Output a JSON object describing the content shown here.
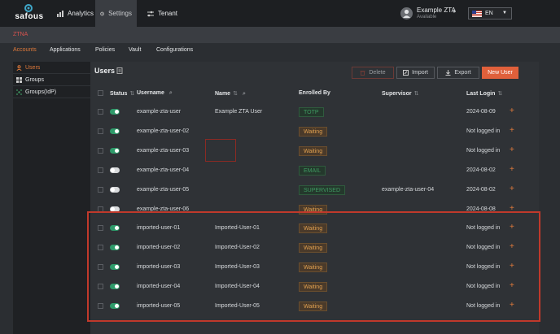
{
  "header": {
    "logo_text": "safous",
    "nav": [
      {
        "label": "Analytics",
        "icon": "chart-icon"
      },
      {
        "label": "Settings",
        "icon": "gear-icon",
        "active": true
      },
      {
        "label": "Tenant",
        "icon": "sliders-icon"
      }
    ],
    "user": {
      "name": "Example ZTA",
      "status": "Available"
    },
    "language": "EN"
  },
  "module": {
    "label": "ZTNA"
  },
  "tabs": [
    "Accounts",
    "Applications",
    "Policies",
    "Vault",
    "Configurations"
  ],
  "sidebar": {
    "items": [
      {
        "label": "Users",
        "active": true
      },
      {
        "label": "Groups"
      },
      {
        "label": "Groups(IdP)"
      }
    ]
  },
  "page": {
    "title": "Users",
    "buttons": {
      "delete": "Delete",
      "import": "Import",
      "export": "Export",
      "new_user": "New User"
    }
  },
  "table": {
    "columns": [
      "Status",
      "Username",
      "Name",
      "Enrolled By",
      "Supervisor",
      "Last Login"
    ],
    "rows": [
      {
        "enabled": true,
        "username": "example-zta-user",
        "name": "Example ZTA User",
        "enrolled": "TOTP",
        "enrolled_style": "green",
        "supervisor": "",
        "last_login": "2024-08-09"
      },
      {
        "enabled": true,
        "username": "example-zta-user-02",
        "name": "",
        "enrolled": "Waiting",
        "enrolled_style": "waiting",
        "supervisor": "",
        "last_login": "Not logged in"
      },
      {
        "enabled": true,
        "username": "example-zta-user-03",
        "name": "",
        "enrolled": "Waiting",
        "enrolled_style": "waiting",
        "supervisor": "",
        "last_login": "Not logged in"
      },
      {
        "enabled": false,
        "username": "example-zta-user-04",
        "name": "",
        "enrolled": "EMAIL",
        "enrolled_style": "green",
        "supervisor": "",
        "last_login": "2024-08-02"
      },
      {
        "enabled": false,
        "username": "example-zta-user-05",
        "name": "",
        "enrolled": "SUPERVISED",
        "enrolled_style": "green",
        "supervisor": "example-zta-user-04",
        "last_login": "2024-08-02"
      },
      {
        "enabled": false,
        "username": "example-zta-user-06",
        "name": "",
        "enrolled": "Waiting",
        "enrolled_style": "waiting",
        "supervisor": "",
        "last_login": "2024-08-08"
      },
      {
        "enabled": true,
        "username": "imported-user-01",
        "name": "Imported-User-01",
        "enrolled": "Waiting",
        "enrolled_style": "waiting",
        "supervisor": "",
        "last_login": "Not logged in"
      },
      {
        "enabled": true,
        "username": "imported-user-02",
        "name": "Imported-User-02",
        "enrolled": "Waiting",
        "enrolled_style": "waiting",
        "supervisor": "",
        "last_login": "Not logged in"
      },
      {
        "enabled": true,
        "username": "imported-user-03",
        "name": "Imported-User-03",
        "enrolled": "Waiting",
        "enrolled_style": "waiting",
        "supervisor": "",
        "last_login": "Not logged in"
      },
      {
        "enabled": true,
        "username": "imported-user-04",
        "name": "Imported-User-04",
        "enrolled": "Waiting",
        "enrolled_style": "waiting",
        "supervisor": "",
        "last_login": "Not logged in"
      },
      {
        "enabled": true,
        "username": "imported-user-05",
        "name": "Imported-User-05",
        "enrolled": "Waiting",
        "enrolled_style": "waiting",
        "supervisor": "",
        "last_login": "Not logged in"
      }
    ]
  },
  "colors": {
    "accent": "#e07a3b",
    "highlight": "#c0392b",
    "success": "#2e9b6a"
  }
}
